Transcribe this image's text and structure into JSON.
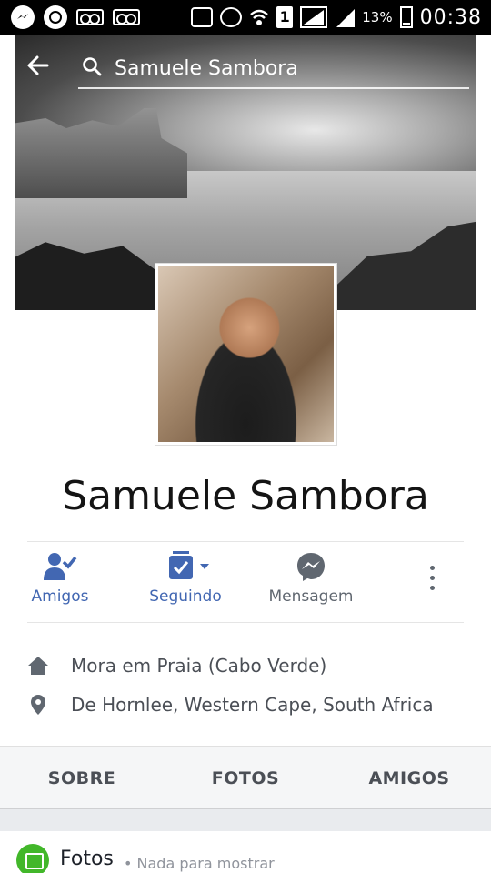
{
  "status_bar": {
    "battery_percent": "13%",
    "time": "00:38",
    "sim_slot": "1"
  },
  "search": {
    "query": "Samuele Sambora"
  },
  "profile": {
    "name": "Samuele Sambora"
  },
  "actions": {
    "friends_label": "Amigos",
    "following_label": "Seguindo",
    "message_label": "Mensagem"
  },
  "info": {
    "lives_in": "Mora em Praia (Cabo Verde)",
    "from": "De Hornlee, Western Cape, South Africa"
  },
  "tabs": [
    {
      "label": "SOBRE"
    },
    {
      "label": "FOTOS"
    },
    {
      "label": "AMIGOS"
    }
  ],
  "photos_section": {
    "title": "Fotos",
    "subtitle": "• Nada para mostrar"
  },
  "colors": {
    "facebook_blue": "#4267b2",
    "photos_green": "#42b72a",
    "status_bar_bg": "#000000"
  }
}
